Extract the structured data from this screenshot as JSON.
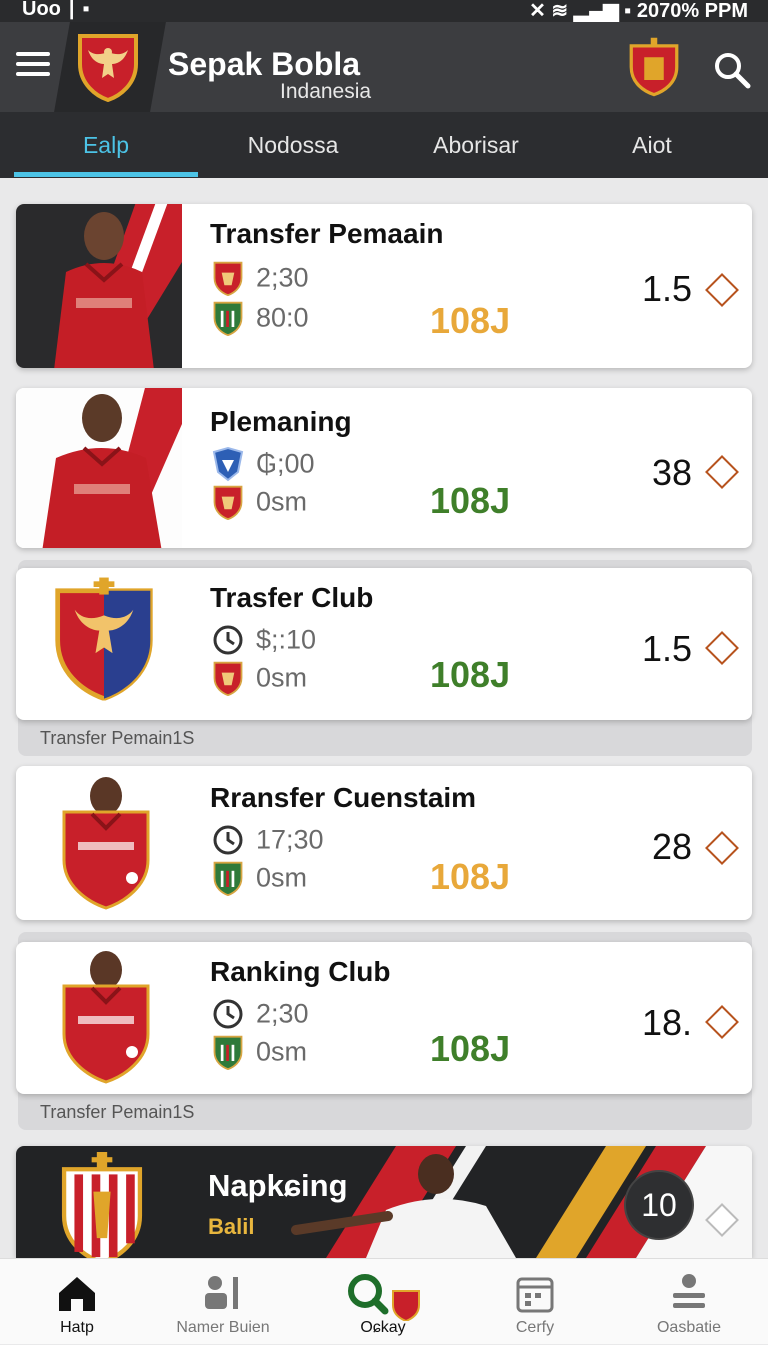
{
  "status_bar": {
    "left": "Uoo",
    "right": "2070% PPM"
  },
  "app_bar": {
    "title": "Sepak Bobla",
    "subtitle": "Indanesia"
  },
  "tabs": [
    {
      "label": "Ealp",
      "active": true
    },
    {
      "label": "Nodossa",
      "active": false
    },
    {
      "label": "Aborisar",
      "active": false
    },
    {
      "label": "Aiot",
      "active": false
    }
  ],
  "cards": [
    {
      "title": "Transfer Pemaain",
      "stat1": "2;30",
      "stat2": "80:0",
      "value": "108J",
      "value_color": "#e8a83a",
      "odds": "1.5"
    },
    {
      "title": "Plemaning",
      "stat1": "₲;00",
      "stat2": "0sm",
      "value": "108J",
      "value_color": "#3f7f2a",
      "odds": "38"
    },
    {
      "title": "Trasfer Club",
      "stat1": "$;:10",
      "stat2": "0sm",
      "value": "108J",
      "value_color": "#3f7f2a",
      "odds": "1.5"
    },
    {
      "title": "Rransfer Cuenstaim",
      "stat1": "17;30",
      "stat2": "0sm",
      "value": "108J",
      "value_color": "#e8a83a",
      "odds": "28"
    },
    {
      "title": "Ranking Club",
      "stat1": "2;30",
      "stat2": "0sm",
      "value": "108J",
      "value_color": "#3f7f2a",
      "odds": "18."
    }
  ],
  "group_labels": [
    "Transfer Pemain1S",
    "Transfer Pemain1S"
  ],
  "promo": {
    "title": "Napkɕing",
    "subtitle": "Balil",
    "badge": "10"
  },
  "bottom_nav": [
    {
      "label": "Hatp",
      "active": true
    },
    {
      "label": "Namer Buien",
      "active": false
    },
    {
      "label": "Oɕkay",
      "active": false
    },
    {
      "label": "Cerfy",
      "active": false
    },
    {
      "label": "Oasbatie",
      "active": false
    }
  ],
  "colors": {
    "accent": "#4cc3e6",
    "club_red": "#c8202a",
    "gold": "#e0a52a",
    "green_value": "#3f7f2a"
  }
}
